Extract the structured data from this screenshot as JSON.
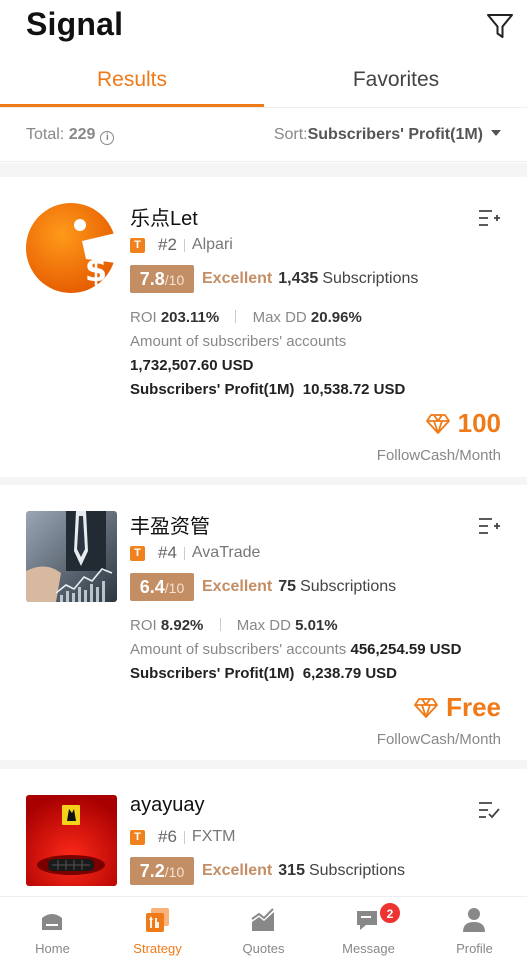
{
  "header": {
    "title": "Signal",
    "filter_icon": "filter-icon"
  },
  "tabs": [
    {
      "label": "Results",
      "active": true
    },
    {
      "label": "Favorites",
      "active": false
    }
  ],
  "summary": {
    "total_label": "Total:",
    "total_value": "229",
    "sort_label": "Sort:",
    "sort_value": "Subscribers' Profit(1M)"
  },
  "colors": {
    "accent": "#f07a18",
    "score_bg": "#c48e64",
    "badge_red": "#e33333"
  },
  "signals": [
    {
      "name": "乐点Let",
      "rank": "#2",
      "broker": "Alpari",
      "score": "7.8",
      "score_max": "/10",
      "rating": "Excellent",
      "subscriptions_count": "1,435",
      "subscriptions_label": "Subscriptions",
      "roi_label": "ROI",
      "roi_value": "203.11%",
      "maxdd_label": "Max DD",
      "maxdd_value": "20.96%",
      "accounts_label": "Amount of subscribers' accounts",
      "accounts_value": "1,732,507.60 USD",
      "profit_label": "Subscribers' Profit(1M)",
      "profit_value": "10,538.72 USD",
      "price": "100",
      "price_unit": "FollowCash/Month"
    },
    {
      "name": "丰盈资管",
      "rank": "#4",
      "broker": "AvaTrade",
      "score": "6.4",
      "score_max": "/10",
      "rating": "Excellent",
      "subscriptions_count": "75",
      "subscriptions_label": "Subscriptions",
      "roi_label": "ROI",
      "roi_value": "8.92%",
      "maxdd_label": "Max DD",
      "maxdd_value": "5.01%",
      "accounts_label": "Amount of subscribers' accounts",
      "accounts_value": "456,254.59 USD",
      "profit_label": "Subscribers' Profit(1M)",
      "profit_value": "6,238.79 USD",
      "price": "Free",
      "price_unit": "FollowCash/Month"
    },
    {
      "name": "ayayuay",
      "rank": "#6",
      "broker": "FXTM",
      "score": "7.2",
      "score_max": "/10",
      "rating": "Excellent",
      "subscriptions_count": "315",
      "subscriptions_label": "Subscriptions"
    }
  ],
  "t_badge": "T",
  "info_icon": "i",
  "nav": [
    {
      "label": "Home",
      "icon": "home-icon"
    },
    {
      "label": "Strategy",
      "icon": "strategy-icon",
      "active": true
    },
    {
      "label": "Quotes",
      "icon": "quotes-icon"
    },
    {
      "label": "Message",
      "icon": "message-icon",
      "badge": "2"
    },
    {
      "label": "Profile",
      "icon": "profile-icon"
    }
  ]
}
